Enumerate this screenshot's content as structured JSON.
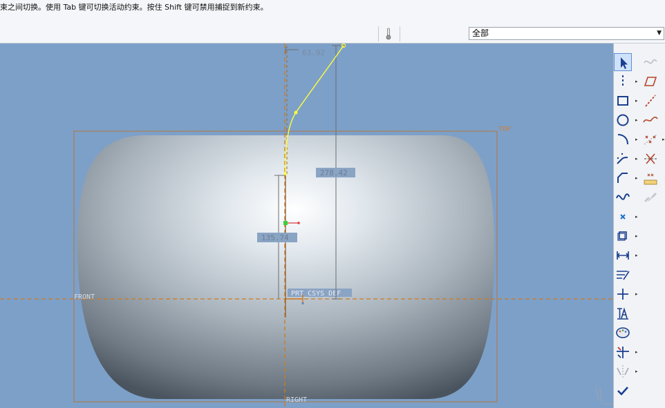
{
  "status_message": "束之间切换。使用 Tab 键可切换活动约束。按住 Shift 键可禁用捕捉到新约束。",
  "filter_select": {
    "value": "全部"
  },
  "viewport": {
    "dimensions": {
      "top_offset": "63.92",
      "total_height": "278.42",
      "lower_height": "135.74"
    },
    "datum_labels": {
      "top": "TOP",
      "front": "FRONT",
      "right": "RIGHT",
      "csys": "PRT_CSYS_DEF"
    }
  },
  "toolbar": {
    "left_column": [
      "select",
      "centerline",
      "rectangle",
      "circle",
      "arc",
      "fillet",
      "chamfer",
      "spline",
      "point",
      "offset",
      "dimension",
      "modify",
      "constraint",
      "text",
      "palette",
      "trim",
      "mirror",
      "done"
    ],
    "right_column": [
      "curve-disabled",
      "parallelogram",
      "construction-line",
      "freeform-curve",
      "axis-point",
      "delete-segment",
      "equal-constraint",
      "link-disabled"
    ]
  },
  "colors": {
    "viewport_bg": "#7da0c8",
    "sketch_curve": "#ffff3a",
    "datum": "#c8772a",
    "dimension_box": "#8aa4c4"
  }
}
